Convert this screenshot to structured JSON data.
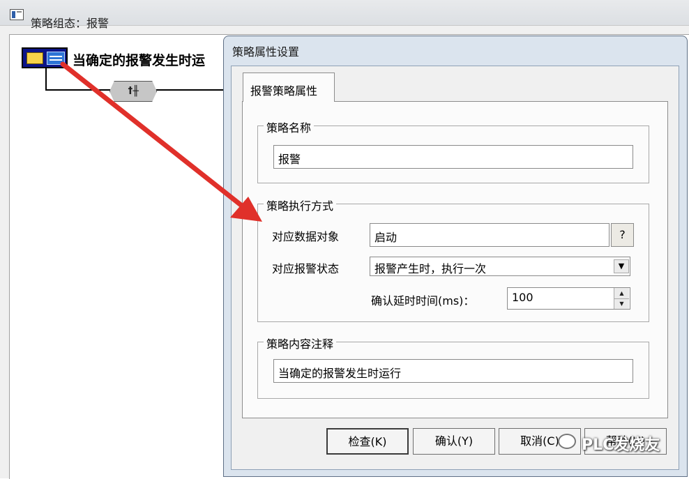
{
  "background_window": {
    "title": "策略组态：报警",
    "strategy_row_label": "当确定的报警发生时运",
    "strategy_block_glyph": "ꝉ╫"
  },
  "dialog": {
    "title": "策略属性设置",
    "tab_label": "报警策略属性",
    "strategy_name_group": {
      "label": "策略名称",
      "value": "报警"
    },
    "execution_group": {
      "label": "策略执行方式",
      "data_object_label": "对应数据对象",
      "data_object_value": "启动",
      "browse_button": "?",
      "alarm_state_label": "对应报警状态",
      "alarm_state_value": "报警产生时，执行一次",
      "delay_label": "确认延时时间(ms)：",
      "delay_value": "100"
    },
    "comment_group": {
      "label": "策略内容注释",
      "value": "当确定的报警发生时运行"
    },
    "buttons": {
      "check": "检查(K)",
      "confirm": "确认(Y)",
      "cancel": "取消(C)",
      "help": "帮助(H)"
    }
  },
  "watermark": "PLC发烧友",
  "colors": {
    "annotation_arrow": "#e0302a",
    "icon_background": "#0c1488",
    "dialog_frame": "#dbe4ee"
  }
}
